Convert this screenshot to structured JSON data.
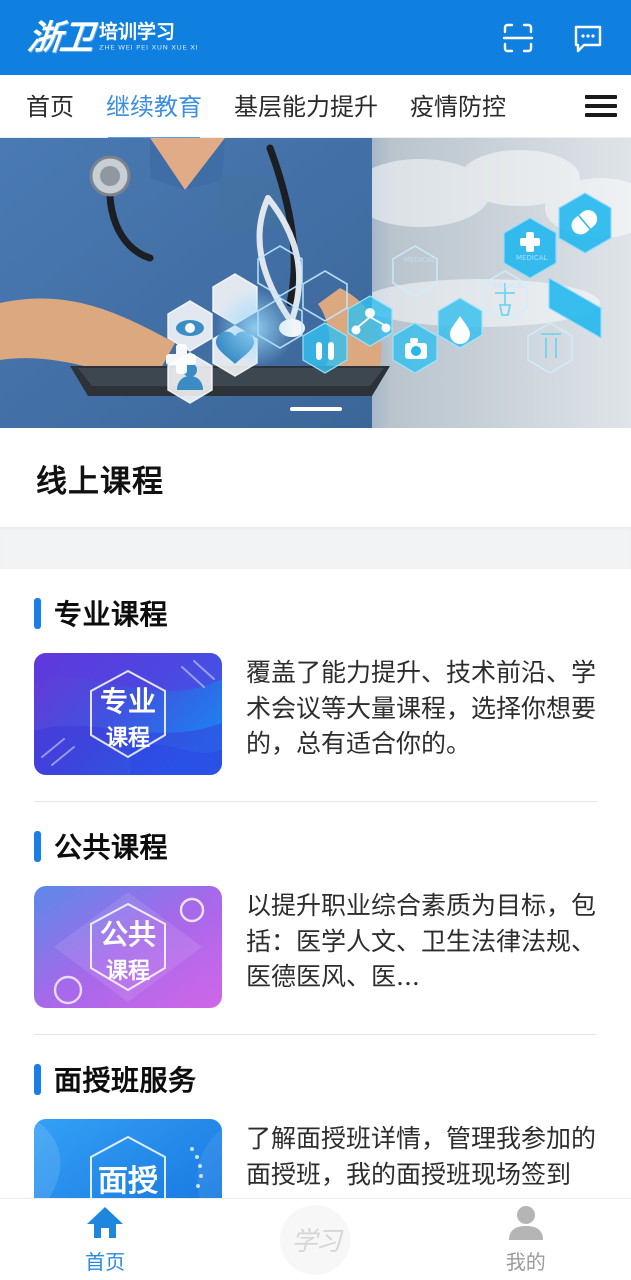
{
  "header": {
    "logo_mark": "浙卫",
    "logo_cn": "培训学习",
    "logo_pinyin": "ZHE WEI PEI XUN XUE XI",
    "scan_icon": "scan-icon",
    "message_icon": "message-icon",
    "bg_color": "#1080e0"
  },
  "nav": {
    "tabs": [
      {
        "label": "首页",
        "active": false
      },
      {
        "label": "继续教育",
        "active": true
      },
      {
        "label": "基层能力提升",
        "active": false
      },
      {
        "label": "疫情防控",
        "active": false
      }
    ],
    "menu_icon": "hamburger-menu-icon",
    "active_color": "#3b8ee0"
  },
  "banner": {
    "alt": "医疗科技横幅：身着蓝色手术服的医生手持平板，六边形医疗图标叠加",
    "slide_indicator": "1"
  },
  "main": {
    "page_title": "线上课程",
    "sections": [
      {
        "title": "专业课程",
        "thumb_top": "专业",
        "thumb_bottom": "课程",
        "thumb_gradient_from": "#6b35d6",
        "thumb_gradient_to": "#1f7ff0",
        "description": "覆盖了能力提升、技术前沿、学术会议等大量课程，选择你想要的，总有适合你的。"
      },
      {
        "title": "公共课程",
        "thumb_top": "公共",
        "thumb_bottom": "课程",
        "thumb_gradient_from": "#5b8ae8",
        "thumb_gradient_to": "#d166e8",
        "description": "以提升职业综合素质为目标，包括：医学人文、卫生法律法规、医德医风、医..."
      },
      {
        "title": "面授班服务",
        "thumb_top": "面授",
        "thumb_bottom": "",
        "thumb_gradient_from": "#2f97f0",
        "thumb_gradient_to": "#1679e0",
        "description": "了解面授班详情，管理我参加的面授班，我的面授班现场签到"
      }
    ]
  },
  "bottom_nav": {
    "items": [
      {
        "label": "首页",
        "icon": "home-icon",
        "active": true
      },
      {
        "label": "学习",
        "icon": "study-icon",
        "active": false
      },
      {
        "label": "我的",
        "icon": "person-icon",
        "active": false
      }
    ],
    "active_color": "#2b8ae0"
  }
}
